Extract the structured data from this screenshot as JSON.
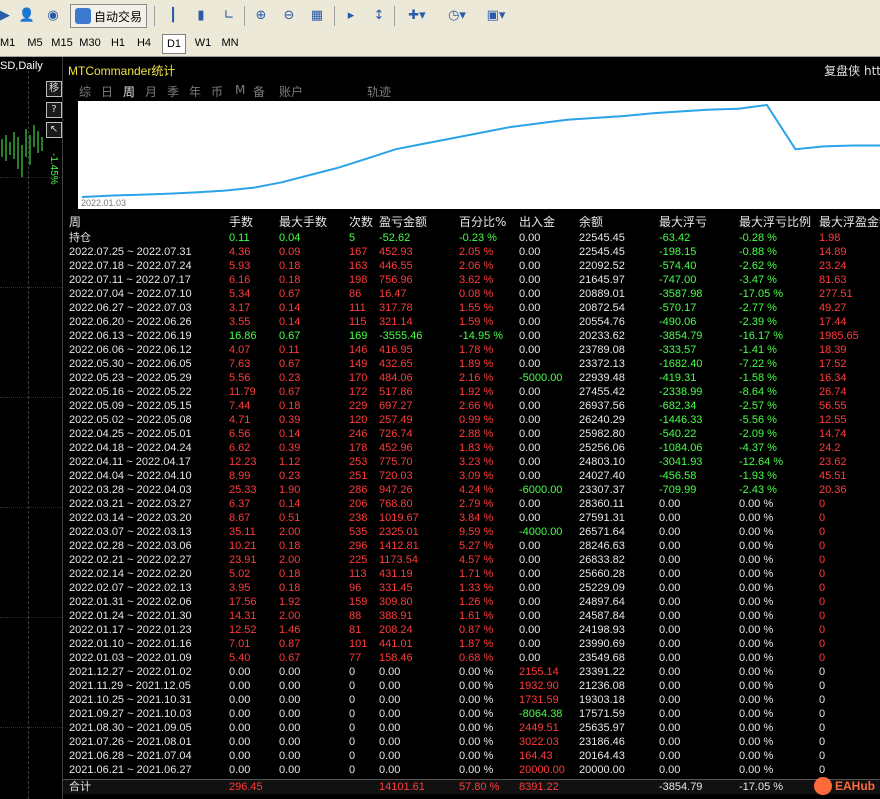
{
  "toolbar": {
    "auto_trade_label": "自动交易",
    "timeframes": [
      "M1",
      "M5",
      "M15",
      "M30",
      "H1",
      "H4",
      "D1",
      "W1",
      "MN"
    ],
    "selected_timeframe": "D1"
  },
  "chart": {
    "title": "SD,Daily",
    "side_buttons": [
      "移",
      "?",
      "↖"
    ],
    "vertical_label": "-1.45%"
  },
  "panel": {
    "title": "MTCommander统计",
    "right_text": "复盘侠 htt",
    "tabs": [
      "综",
      "日",
      "周",
      "月",
      "季",
      "年",
      "币",
      "M",
      "备",
      "账户",
      "轨迹"
    ],
    "active_tab": "周",
    "graph_start_label": "2022.01.03",
    "headers": [
      "周",
      "手数",
      "最大手数",
      "次数",
      "盈亏金额",
      "百分比%",
      "出入金",
      "余额",
      "最大浮亏",
      "最大浮亏比例",
      "最大浮盈金额"
    ],
    "rows": [
      {
        "period": "持仓",
        "lots": "0.11",
        "maxlots": "0.04",
        "count": "5",
        "pnl": "-52.62",
        "pct": "-0.23 %",
        "flow": "0.00",
        "balance": "22545.45",
        "maxdd": "-63.42",
        "ddpct": "-0.28 %",
        "maxfp": "1.98",
        "color": "green"
      },
      {
        "period": "2022.07.25 ~ 2022.07.31",
        "lots": "4.36",
        "maxlots": "0.09",
        "count": "167",
        "pnl": "452.93",
        "pct": "2.05 %",
        "flow": "0.00",
        "balance": "22545.45",
        "maxdd": "-198.15",
        "ddpct": "-0.88 %",
        "maxfp": "14.89",
        "color": "red"
      },
      {
        "period": "2022.07.18 ~ 2022.07.24",
        "lots": "5.93",
        "maxlots": "0.18",
        "count": "163",
        "pnl": "446.55",
        "pct": "2.06 %",
        "flow": "0.00",
        "balance": "22092.52",
        "maxdd": "-574.40",
        "ddpct": "-2.62 %",
        "maxfp": "23.24",
        "color": "red"
      },
      {
        "period": "2022.07.11 ~ 2022.07.17",
        "lots": "6.16",
        "maxlots": "0.18",
        "count": "198",
        "pnl": "756.96",
        "pct": "3.62 %",
        "flow": "0.00",
        "balance": "21645.97",
        "maxdd": "-747.00",
        "ddpct": "-3.47 %",
        "maxfp": "81.63",
        "color": "red"
      },
      {
        "period": "2022.07.04 ~ 2022.07.10",
        "lots": "5.34",
        "maxlots": "0.67",
        "count": "86",
        "pnl": "16.47",
        "pct": "0.08 %",
        "flow": "0.00",
        "balance": "20889.01",
        "maxdd": "-3587.98",
        "ddpct": "-17.05 %",
        "maxfp": "277.51",
        "color": "red"
      },
      {
        "period": "2022.06.27 ~ 2022.07.03",
        "lots": "3.17",
        "maxlots": "0.14",
        "count": "111",
        "pnl": "317.78",
        "pct": "1.55 %",
        "flow": "0.00",
        "balance": "20872.54",
        "maxdd": "-570.17",
        "ddpct": "-2.77 %",
        "maxfp": "49.27",
        "color": "red"
      },
      {
        "period": "2022.06.20 ~ 2022.06.26",
        "lots": "3.55",
        "maxlots": "0.14",
        "count": "115",
        "pnl": "321.14",
        "pct": "1.59 %",
        "flow": "0.00",
        "balance": "20554.76",
        "maxdd": "-490.06",
        "ddpct": "-2.39 %",
        "maxfp": "17.44",
        "color": "red"
      },
      {
        "period": "2022.06.13 ~ 2022.06.19",
        "lots": "16.86",
        "maxlots": "0.67",
        "count": "169",
        "pnl": "-3555.46",
        "pct": "-14.95 %",
        "flow": "0.00",
        "balance": "20233.62",
        "maxdd": "-3854.79",
        "ddpct": "-16.17 %",
        "maxfp": "1985.65",
        "color": "green"
      },
      {
        "period": "2022.06.06 ~ 2022.06.12",
        "lots": "4.07",
        "maxlots": "0.11",
        "count": "146",
        "pnl": "416.95",
        "pct": "1.78 %",
        "flow": "0.00",
        "balance": "23789.08",
        "maxdd": "-333.57",
        "ddpct": "-1.41 %",
        "maxfp": "18.39",
        "color": "red"
      },
      {
        "period": "2022.05.30 ~ 2022.06.05",
        "lots": "7.63",
        "maxlots": "0.67",
        "count": "149",
        "pnl": "432.65",
        "pct": "1.89 %",
        "flow": "0.00",
        "balance": "23372.13",
        "maxdd": "-1682.40",
        "ddpct": "-7.22 %",
        "maxfp": "17.52",
        "color": "red"
      },
      {
        "period": "2022.05.23 ~ 2022.05.29",
        "lots": "5.56",
        "maxlots": "0.23",
        "count": "170",
        "pnl": "484.06",
        "pct": "2.16 %",
        "flow": "-5000.00",
        "balance": "22939.48",
        "maxdd": "-419.31",
        "ddpct": "-1.58 %",
        "maxfp": "16.34",
        "color": "red"
      },
      {
        "period": "2022.05.16 ~ 2022.05.22",
        "lots": "11.79",
        "maxlots": "0.67",
        "count": "172",
        "pnl": "517.86",
        "pct": "1.92 %",
        "flow": "0.00",
        "balance": "27455.42",
        "maxdd": "-2338.99",
        "ddpct": "-8.64 %",
        "maxfp": "26.74",
        "color": "red"
      },
      {
        "period": "2022.05.09 ~ 2022.05.15",
        "lots": "7.44",
        "maxlots": "0.18",
        "count": "229",
        "pnl": "697.27",
        "pct": "2.66 %",
        "flow": "0.00",
        "balance": "26937.56",
        "maxdd": "-682.34",
        "ddpct": "-2.57 %",
        "maxfp": "56.55",
        "color": "red"
      },
      {
        "period": "2022.05.02 ~ 2022.05.08",
        "lots": "4.71",
        "maxlots": "0.39",
        "count": "120",
        "pnl": "257.49",
        "pct": "0.99 %",
        "flow": "0.00",
        "balance": "26240.29",
        "maxdd": "-1446.33",
        "ddpct": "-5.56 %",
        "maxfp": "12.55",
        "color": "red"
      },
      {
        "period": "2022.04.25 ~ 2022.05.01",
        "lots": "6.56",
        "maxlots": "0.14",
        "count": "246",
        "pnl": "726.74",
        "pct": "2.88 %",
        "flow": "0.00",
        "balance": "25982.80",
        "maxdd": "-540.22",
        "ddpct": "-2.09 %",
        "maxfp": "14.74",
        "color": "red"
      },
      {
        "period": "2022.04.18 ~ 2022.04.24",
        "lots": "6.62",
        "maxlots": "0.39",
        "count": "178",
        "pnl": "452.96",
        "pct": "1.83 %",
        "flow": "0.00",
        "balance": "25256.06",
        "maxdd": "-1084.06",
        "ddpct": "-4.37 %",
        "maxfp": "24.2",
        "color": "red"
      },
      {
        "period": "2022.04.11 ~ 2022.04.17",
        "lots": "12.23",
        "maxlots": "1.12",
        "count": "253",
        "pnl": "775.70",
        "pct": "3.23 %",
        "flow": "0.00",
        "balance": "24803.10",
        "maxdd": "-3041.93",
        "ddpct": "-12.64 %",
        "maxfp": "23.62",
        "color": "red"
      },
      {
        "period": "2022.04.04 ~ 2022.04.10",
        "lots": "8.99",
        "maxlots": "0.23",
        "count": "251",
        "pnl": "720.03",
        "pct": "3.09 %",
        "flow": "0.00",
        "balance": "24027.40",
        "maxdd": "-456.58",
        "ddpct": "-1.93 %",
        "maxfp": "45.51",
        "color": "red"
      },
      {
        "period": "2022.03.28 ~ 2022.04.03",
        "lots": "25.33",
        "maxlots": "1.90",
        "count": "286",
        "pnl": "947.26",
        "pct": "4.24 %",
        "flow": "-6000.00",
        "balance": "23307.37",
        "maxdd": "-709.99",
        "ddpct": "-2.43 %",
        "maxfp": "20.36",
        "color": "red"
      },
      {
        "period": "2022.03.21 ~ 2022.03.27",
        "lots": "6.37",
        "maxlots": "0.14",
        "count": "206",
        "pnl": "768.80",
        "pct": "2.79 %",
        "flow": "0.00",
        "balance": "28360.11",
        "maxdd": "0.00",
        "ddpct": "0.00 %",
        "maxfp": "0",
        "color": "red"
      },
      {
        "period": "2022.03.14 ~ 2022.03.20",
        "lots": "8.67",
        "maxlots": "0.51",
        "count": "238",
        "pnl": "1019.67",
        "pct": "3.84 %",
        "flow": "0.00",
        "balance": "27591.31",
        "maxdd": "0.00",
        "ddpct": "0.00 %",
        "maxfp": "0",
        "color": "red"
      },
      {
        "period": "2022.03.07 ~ 2022.03.13",
        "lots": "35.11",
        "maxlots": "2.00",
        "count": "535",
        "pnl": "2325.01",
        "pct": "9.59 %",
        "flow": "-4000.00",
        "balance": "26571.64",
        "maxdd": "0.00",
        "ddpct": "0.00 %",
        "maxfp": "0",
        "color": "red"
      },
      {
        "period": "2022.02.28 ~ 2022.03.06",
        "lots": "10.21",
        "maxlots": "0.18",
        "count": "296",
        "pnl": "1412.81",
        "pct": "5.27 %",
        "flow": "0.00",
        "balance": "28246.63",
        "maxdd": "0.00",
        "ddpct": "0.00 %",
        "maxfp": "0",
        "color": "red"
      },
      {
        "period": "2022.02.21 ~ 2022.02.27",
        "lots": "23.91",
        "maxlots": "2.00",
        "count": "225",
        "pnl": "1173.54",
        "pct": "4.57 %",
        "flow": "0.00",
        "balance": "26833.82",
        "maxdd": "0.00",
        "ddpct": "0.00 %",
        "maxfp": "0",
        "color": "red"
      },
      {
        "period": "2022.02.14 ~ 2022.02.20",
        "lots": "5.02",
        "maxlots": "0.18",
        "count": "113",
        "pnl": "431.19",
        "pct": "1.71 %",
        "flow": "0.00",
        "balance": "25660.28",
        "maxdd": "0.00",
        "ddpct": "0.00 %",
        "maxfp": "0",
        "color": "red"
      },
      {
        "period": "2022.02.07 ~ 2022.02.13",
        "lots": "3.95",
        "maxlots": "0.18",
        "count": "96",
        "pnl": "331.45",
        "pct": "1.33 %",
        "flow": "0.00",
        "balance": "25229.09",
        "maxdd": "0.00",
        "ddpct": "0.00 %",
        "maxfp": "0",
        "color": "red"
      },
      {
        "period": "2022.01.31 ~ 2022.02.06",
        "lots": "17.56",
        "maxlots": "1.92",
        "count": "159",
        "pnl": "309.80",
        "pct": "1.26 %",
        "flow": "0.00",
        "balance": "24897.64",
        "maxdd": "0.00",
        "ddpct": "0.00 %",
        "maxfp": "0",
        "color": "red"
      },
      {
        "period": "2022.01.24 ~ 2022.01.30",
        "lots": "14.31",
        "maxlots": "2.00",
        "count": "88",
        "pnl": "388.91",
        "pct": "1.61 %",
        "flow": "0.00",
        "balance": "24587.84",
        "maxdd": "0.00",
        "ddpct": "0.00 %",
        "maxfp": "0",
        "color": "red"
      },
      {
        "period": "2022.01.17 ~ 2022.01.23",
        "lots": "12.52",
        "maxlots": "1.46",
        "count": "81",
        "pnl": "208.24",
        "pct": "0.87 %",
        "flow": "0.00",
        "balance": "24198.93",
        "maxdd": "0.00",
        "ddpct": "0.00 %",
        "maxfp": "0",
        "color": "red"
      },
      {
        "period": "2022.01.10 ~ 2022.01.16",
        "lots": "7.01",
        "maxlots": "0.87",
        "count": "101",
        "pnl": "441.01",
        "pct": "1.87 %",
        "flow": "0.00",
        "balance": "23990.69",
        "maxdd": "0.00",
        "ddpct": "0.00 %",
        "maxfp": "0",
        "color": "red"
      },
      {
        "period": "2022.01.03 ~ 2022.01.09",
        "lots": "5.40",
        "maxlots": "0.67",
        "count": "77",
        "pnl": "158.46",
        "pct": "0.68 %",
        "flow": "0.00",
        "balance": "23549.68",
        "maxdd": "0.00",
        "ddpct": "0.00 %",
        "maxfp": "0",
        "color": "red"
      },
      {
        "period": "2021.12.27 ~ 2022.01.02",
        "lots": "0.00",
        "maxlots": "0.00",
        "count": "0",
        "pnl": "0.00",
        "pct": "0.00 %",
        "flow": "2155.14",
        "balance": "23391.22",
        "maxdd": "0.00",
        "ddpct": "0.00 %",
        "maxfp": "0",
        "color": "white",
        "flowcolor": "red"
      },
      {
        "period": "2021.11.29 ~ 2021.12.05",
        "lots": "0.00",
        "maxlots": "0.00",
        "count": "0",
        "pnl": "0.00",
        "pct": "0.00 %",
        "flow": "1932.90",
        "balance": "21236.08",
        "maxdd": "0.00",
        "ddpct": "0.00 %",
        "maxfp": "0",
        "color": "white",
        "flowcolor": "red"
      },
      {
        "period": "2021.10.25 ~ 2021.10.31",
        "lots": "0.00",
        "maxlots": "0.00",
        "count": "0",
        "pnl": "0.00",
        "pct": "0.00 %",
        "flow": "1731.59",
        "balance": "19303.18",
        "maxdd": "0.00",
        "ddpct": "0.00 %",
        "maxfp": "0",
        "color": "white",
        "flowcolor": "red"
      },
      {
        "period": "2021.09.27 ~ 2021.10.03",
        "lots": "0.00",
        "maxlots": "0.00",
        "count": "0",
        "pnl": "0.00",
        "pct": "0.00 %",
        "flow": "-8064.38",
        "balance": "17571.59",
        "maxdd": "0.00",
        "ddpct": "0.00 %",
        "maxfp": "0",
        "color": "white",
        "flowcolor": "green"
      },
      {
        "period": "2021.08.30 ~ 2021.09.05",
        "lots": "0.00",
        "maxlots": "0.00",
        "count": "0",
        "pnl": "0.00",
        "pct": "0.00 %",
        "flow": "2449.51",
        "balance": "25635.97",
        "maxdd": "0.00",
        "ddpct": "0.00 %",
        "maxfp": "0",
        "color": "white",
        "flowcolor": "red"
      },
      {
        "period": "2021.07.26 ~ 2021.08.01",
        "lots": "0.00",
        "maxlots": "0.00",
        "count": "0",
        "pnl": "0.00",
        "pct": "0.00 %",
        "flow": "3022.03",
        "balance": "23186.46",
        "maxdd": "0.00",
        "ddpct": "0.00 %",
        "maxfp": "0",
        "color": "white",
        "flowcolor": "red"
      },
      {
        "period": "2021.06.28 ~ 2021.07.04",
        "lots": "0.00",
        "maxlots": "0.00",
        "count": "0",
        "pnl": "0.00",
        "pct": "0.00 %",
        "flow": "164.43",
        "balance": "20164.43",
        "maxdd": "0.00",
        "ddpct": "0.00 %",
        "maxfp": "0",
        "color": "white",
        "flowcolor": "red"
      },
      {
        "period": "2021.06.21 ~ 2021.06.27",
        "lots": "0.00",
        "maxlots": "0.00",
        "count": "0",
        "pnl": "0.00",
        "pct": "0.00 %",
        "flow": "20000.00",
        "balance": "20000.00",
        "maxdd": "0.00",
        "ddpct": "0.00 %",
        "maxfp": "0",
        "color": "white",
        "flowcolor": "red"
      }
    ],
    "total": {
      "label": "合计",
      "lots": "296.45",
      "pnl": "14101.61",
      "pct": "57.80 %",
      "flow": "8391.22",
      "maxdd": "-3854.79",
      "ddpct": "-17.05 %"
    },
    "equity_curve": [
      0,
      1.5,
      2.5,
      3.5,
      5,
      7,
      10,
      16,
      24,
      32,
      42,
      52,
      58,
      64,
      70,
      76,
      80,
      84,
      86,
      88,
      91,
      93,
      95,
      96,
      100,
      52,
      55,
      56,
      56
    ]
  },
  "watermark": "EAHub",
  "colors": {
    "red": "#ff3b3b",
    "green": "#46ff46",
    "white": "#e6e6e6",
    "line": "#2aa3e8",
    "title": "#f0e442"
  }
}
